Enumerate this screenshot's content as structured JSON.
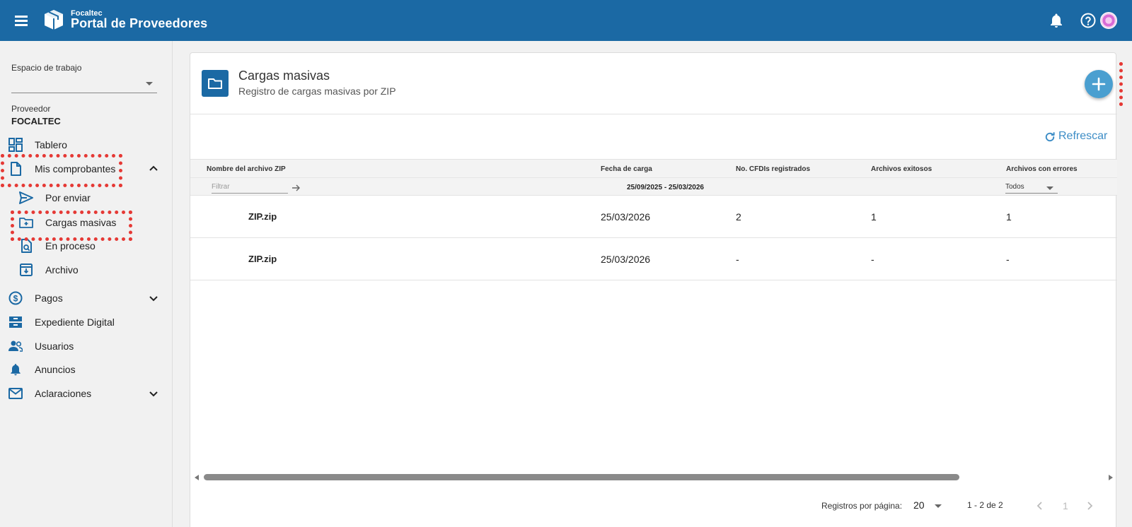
{
  "header": {
    "brand_small": "Focaltec",
    "brand_title": "Portal de Proveedores"
  },
  "sidebar": {
    "workspace_label": "Espacio de trabajo",
    "workspace_value": "",
    "provider_label": "Proveedor",
    "provider_name": "FOCALTEC",
    "items": [
      {
        "label": "Tablero",
        "icon": "dashboard-icon"
      },
      {
        "label": "Mis comprobantes",
        "icon": "document-icon",
        "expanded": true
      },
      {
        "label": "Por enviar",
        "icon": "send-icon"
      },
      {
        "label": "Cargas masivas",
        "icon": "folder-upload-icon"
      },
      {
        "label": "En proceso",
        "icon": "document-search-icon"
      },
      {
        "label": "Archivo",
        "icon": "archive-icon"
      },
      {
        "label": "Pagos",
        "icon": "dollar-icon"
      },
      {
        "label": "Expediente Digital",
        "icon": "cabinet-icon"
      },
      {
        "label": "Usuarios",
        "icon": "users-icon"
      },
      {
        "label": "Anuncios",
        "icon": "bell-icon"
      },
      {
        "label": "Aclaraciones",
        "icon": "mail-icon"
      }
    ]
  },
  "main": {
    "title": "Cargas masivas",
    "subtitle": "Registro de cargas masivas por ZIP",
    "refresh_label": "Refrescar",
    "table": {
      "columns": [
        "Nombre del archivo ZIP",
        "Fecha de carga",
        "No. CFDIs registrados",
        "Archivos exitosos",
        "Archivos con errores"
      ],
      "filter_placeholder": "Filtrar",
      "date_filter": "25/09/2025 - 25/03/2026",
      "errors_filter": "Todos",
      "rows": [
        {
          "name": "ZIP.zip",
          "date": "25/03/2026",
          "cfdis": "2",
          "ok": "1",
          "errors": "1"
        },
        {
          "name": "ZIP.zip",
          "date": "25/03/2026",
          "cfdis": "-",
          "ok": "-",
          "errors": "-"
        }
      ]
    },
    "pagination": {
      "per_page_label": "Registros por página:",
      "per_page_value": "20",
      "range": "1 - 2 de 2",
      "current_page": "1"
    }
  },
  "colors": {
    "primary": "#1b69a4",
    "accent": "#4a9fd0",
    "highlight": "#e53935"
  }
}
